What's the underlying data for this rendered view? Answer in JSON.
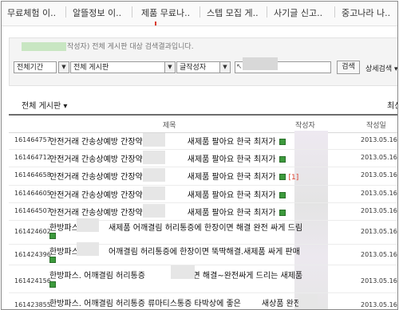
{
  "tabs": [
    "무료체험 이..",
    "알뜰정보 이..",
    "제품 무료나..",
    "스텝 모집 게..",
    "사기글 신고..",
    "중고나라 나.."
  ],
  "search": {
    "scope_text": "작성자) 전체 게시판 대상 검색결과입니다.",
    "period": "전체기간",
    "board": "전체 게시판",
    "field": "글작성자",
    "keyword_value": "",
    "button": "검색",
    "detail": "상세검색"
  },
  "list": {
    "board_select": "전체 게시판",
    "sort_label": "최신",
    "headers": {
      "title": "제목",
      "author": "작성자",
      "date": "작성일"
    }
  },
  "rows": [
    {
      "number": "161464757",
      "title_a": "안전거래 간송상예방 간장약",
      "title_b": "새제품 팔아요 한국 최저가",
      "reply": "",
      "date": "2013.05.16"
    },
    {
      "number": "161464712",
      "title_a": "안전거래 간송상예방 간장약",
      "title_b": "새제품 팔아요 한국 최저가",
      "reply": "",
      "date": "2013.05.16"
    },
    {
      "number": "161464658",
      "title_a": "안전거래 간송상예방 간장약",
      "title_b": "새제품 팔아요 한국 최저가",
      "reply": "[1]",
      "date": "2013.05.16"
    },
    {
      "number": "161464605",
      "title_a": "안전거래 간송상예방 간장약",
      "title_b": "새제품 팔아요 한국 최저가",
      "reply": "",
      "date": "2013.05.16"
    },
    {
      "number": "161464507",
      "title_a": "안전거래 간송상예방 간장약",
      "title_b": "새제품 팔아요 한국 최저가",
      "reply": "",
      "date": "2013.05.16"
    },
    {
      "number": "161424602",
      "title_a": "한방파스.",
      "title_b": "새제품 어깨결림 허리통증에 한장이면 해결 완전 싸게 드림",
      "reply": "",
      "date": "2013.05.16"
    },
    {
      "number": "161424396",
      "title_a": "한방파스.",
      "title_b": "어깨결림 허리통증에 한장이면 뚝딱해결.새제품 싸게 판매",
      "reply": "",
      "date": "2013.05.16"
    },
    {
      "number": "161424156",
      "title_a": "한방파스. 어깨결림 허리통증",
      "title_b": "한장이면 해결~완전싸게 드리는 새제품",
      "reply": "",
      "date": "2013.05.16"
    },
    {
      "number": "161423855",
      "title_a": "한방파스. 어깨결림 허리통증 류마티스통증 타박상에 좋은",
      "title_b": "새상품 완전",
      "reply": "",
      "date": "2013.05.16"
    }
  ]
}
